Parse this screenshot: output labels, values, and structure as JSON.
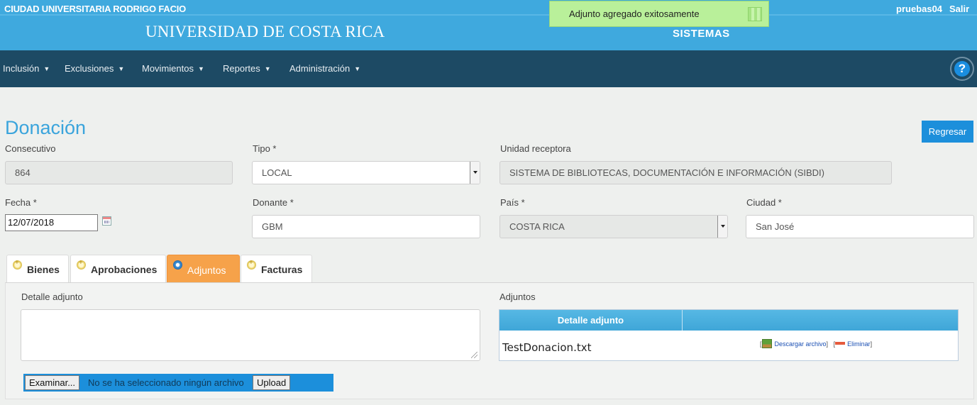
{
  "header": {
    "campus": "CIUDAD UNIVERSITARIA RODRIGO FACIO",
    "university": "UNIVERSIDAD DE COSTA RICA",
    "system": "SISTEMAS",
    "user": "pruebas04",
    "logout": "Salir"
  },
  "toast": {
    "message": "Adjunto agregado exitosamente"
  },
  "nav": {
    "items": [
      {
        "label": "Inclusión"
      },
      {
        "label": "Exclusiones"
      },
      {
        "label": "Movimientos"
      },
      {
        "label": "Reportes"
      },
      {
        "label": "Administración"
      }
    ],
    "caret": "▼",
    "help": "?"
  },
  "page": {
    "title": "Donación",
    "back_button": "Regresar"
  },
  "form": {
    "consecutivo_label": "Consecutivo",
    "consecutivo_value": "864",
    "tipo_label": "Tipo *",
    "tipo_value": "LOCAL",
    "unidad_label": "Unidad receptora",
    "unidad_value": "SISTEMA DE BIBLIOTECAS, DOCUMENTACIÓN E INFORMACIÓN (SIBDI)",
    "fecha_label": "Fecha *",
    "fecha_value": "12/07/2018",
    "donante_label": "Donante *",
    "donante_value": "GBM",
    "pais_label": "País *",
    "pais_value": "COSTA RICA",
    "ciudad_label": "Ciudad *",
    "ciudad_value": "San José"
  },
  "tabs": [
    {
      "label": "Bienes",
      "active": false
    },
    {
      "label": "Aprobaciones",
      "active": false
    },
    {
      "label": "Adjuntos",
      "active": true
    },
    {
      "label": "Facturas",
      "active": false
    }
  ],
  "adjuntos": {
    "detail_label": "Detalle adjunto",
    "list_label": "Adjuntos",
    "browse_button": "Examinar...",
    "no_file_text": "No se ha seleccionado ningún archivo",
    "upload_button": "Upload",
    "table_header": "Detalle adjunto",
    "rows": [
      {
        "name": "TestDonacion.txt",
        "download": "Descargar archivo",
        "delete": "Eliminar"
      }
    ]
  },
  "colors": {
    "banner": "#3fa9de",
    "navbar": "#1d4a64",
    "accent": "#1c8fdb",
    "active_tab": "#f6a24a",
    "toast": "#b9f09a"
  }
}
